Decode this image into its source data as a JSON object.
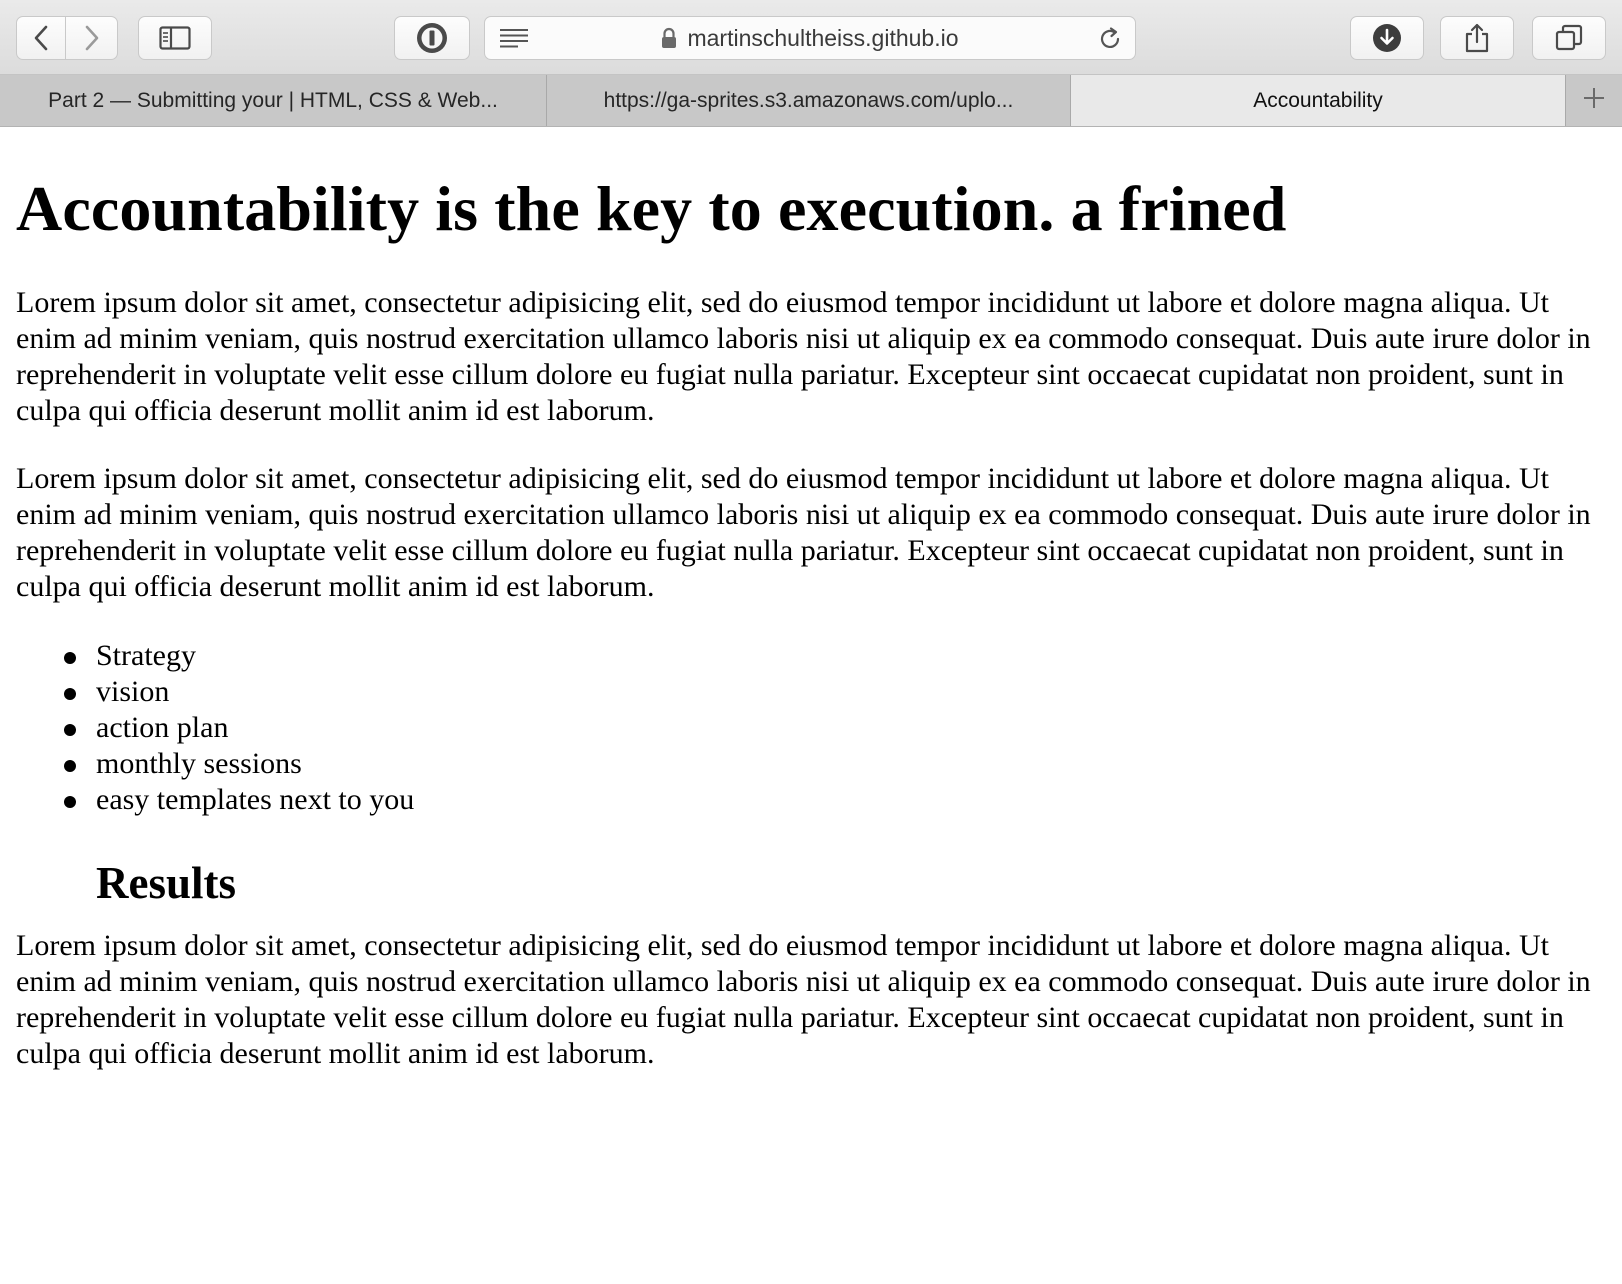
{
  "browser": {
    "url": "martinschultheiss.github.io",
    "tabs": [
      {
        "title": "Part 2 — Submitting your | HTML, CSS & Web..."
      },
      {
        "title": "https://ga-sprites.s3.amazonaws.com/uplo..."
      },
      {
        "title": "Accountability",
        "active": true
      }
    ]
  },
  "page": {
    "heading": "Accountability is the key to execution. a frined",
    "paragraph_1": "Lorem ipsum dolor sit amet, consectetur adipisicing elit, sed do eiusmod tempor incididunt ut labore et dolore magna aliqua. Ut enim ad minim veniam, quis nostrud exercitation ullamco laboris nisi ut aliquip ex ea commodo consequat. Duis aute irure dolor in reprehenderit in voluptate velit esse cillum dolore eu fugiat nulla pariatur. Excepteur sint occaecat cupidatat non proident, sunt in culpa qui officia deserunt mollit anim id est laborum.",
    "paragraph_2": "Lorem ipsum dolor sit amet, consectetur adipisicing elit, sed do eiusmod tempor incididunt ut labore et dolore magna aliqua. Ut enim ad minim veniam, quis nostrud exercitation ullamco laboris nisi ut aliquip ex ea commodo consequat. Duis aute irure dolor in reprehenderit in voluptate velit esse cillum dolore eu fugiat nulla pariatur. Excepteur sint occaecat cupidatat non proident, sunt in culpa qui officia deserunt mollit anim id est laborum.",
    "list": [
      "Strategy",
      "vision",
      "action plan",
      "monthly sessions",
      "easy templates next to you"
    ],
    "subheading": "Results",
    "paragraph_3": "Lorem ipsum dolor sit amet, consectetur adipisicing elit, sed do eiusmod tempor incididunt ut labore et dolore magna aliqua. Ut enim ad minim veniam, quis nostrud exercitation ullamco laboris nisi ut aliquip ex ea commodo consequat. Duis aute irure dolor in reprehenderit in voluptate velit esse cillum dolore eu fugiat nulla pariatur. Excepteur sint occaecat cupidatat non proident, sunt in culpa qui officia deserunt mollit anim id est laborum."
  },
  "icons": {
    "back": "chevron-left-icon",
    "forward": "chevron-right-icon",
    "sidebar": "sidebar-icon",
    "password": "password-manager-icon",
    "reader": "reader-icon",
    "lock": "lock-icon",
    "reload": "reload-icon",
    "downloads": "download-icon",
    "share": "share-icon",
    "tabs": "tab-overview-icon",
    "new_tab": "plus-icon"
  }
}
